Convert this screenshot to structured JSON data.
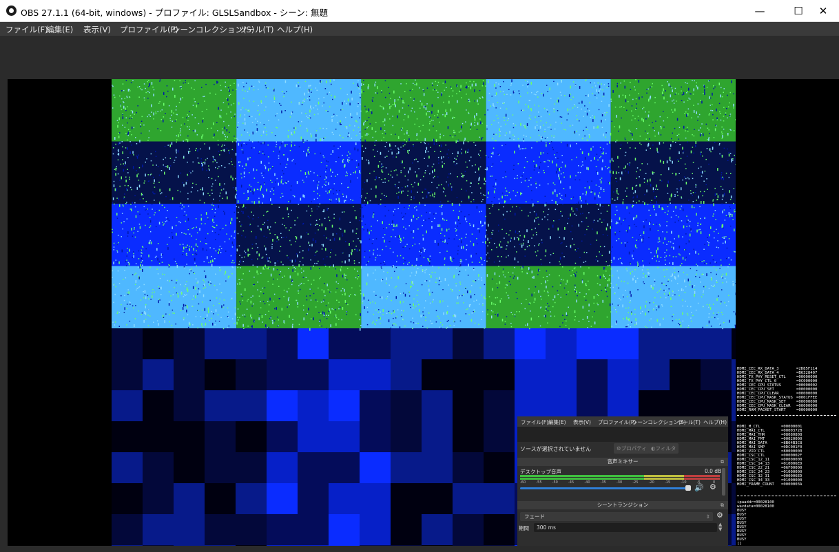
{
  "window": {
    "title": "OBS 27.1.1 (64-bit, windows) - プロファイル: GLSLSandbox - シーン: 無題",
    "controls": {
      "minimize": "—",
      "maximize": "☐",
      "close": "✕"
    }
  },
  "menu": [
    "ファイル(F)",
    "編集(E)",
    "表示(V)",
    "プロファイル(P)",
    "シーンコレクション(S)",
    "ツール(T)",
    "ヘルプ(H)"
  ],
  "register_dump_top": [
    [
      "HDMI_CEC_RX_DATA_3",
      "=2D85F114"
    ],
    [
      "HDMI_CEC_RX_DATA_4",
      "=B6328407"
    ],
    [
      "HDMI_TX_PHY_RESET_CTL",
      "=00000000"
    ],
    [
      "HDMI_TX_PHY_CTL_0",
      "=0C000000"
    ],
    [
      "HDMI_CEC_CPU_STATUS",
      "=00000002"
    ],
    [
      "HDMI_CEC_CPU_SET",
      "=00000000"
    ],
    [
      "HDMI_CEC_CPU_CLEAR",
      "=00000000"
    ],
    [
      "HDMI_CEC_CPU_MASK_STATUS",
      "=0001FFEE"
    ],
    [
      "HDMI_CEC_CPU_MASK_SET",
      "=00000000"
    ],
    [
      "HDMI_CEC_CPU_MASK_CLEAR",
      "=00000000"
    ],
    [
      "HDMI_RAM_PACKET_START",
      "=00000000"
    ]
  ],
  "register_dump_mid": [
    [
      "HDMI_M_CTL",
      "=00000001"
    ],
    [
      "HDMI_MAI_CTL",
      "=0000372B"
    ],
    [
      "HDMI_MAI_THR",
      "=08080808"
    ],
    [
      "HDMI_MAI_FMT",
      "=00020000"
    ],
    [
      "HDMI_MAI_DATA",
      "=8B64B3C8"
    ],
    [
      "HDMI_MAI_SMP",
      "=0DC001F0"
    ],
    [
      "HDMI_VID_CTL",
      "=80000000"
    ],
    [
      "HDMI_CSC_CTL",
      "=0000002F"
    ],
    [
      "HDMI_CSC_12_11",
      "=00000000"
    ],
    [
      "HDMI_CSC_14_13",
      "=010006ED"
    ],
    [
      "HDMI_CSC_22_21",
      "=06F00000"
    ],
    [
      "HDMI_CSC_24_23",
      "=01000000"
    ],
    [
      "HDMI_CSC_32_31",
      "=000006ED"
    ],
    [
      "HDMI_CSC_34_33",
      "=01000000"
    ],
    [
      "HDMI_FRAME_COUNT",
      "=0000003A"
    ]
  ],
  "register_dump_bottom": [
    "ipaaddr=00028100",
    "wavdata=00028100",
    "BUSY",
    "BUSY",
    "BUSY",
    "BUSY",
    "BUSY",
    "BUSY",
    "BUSY",
    "BUSY",
    "[]"
  ],
  "mini_obs": {
    "menu": [
      "ファイル(F)",
      "編集(E)",
      "表示(V)",
      "プロファイル(P)",
      "シーンコレクション(S)",
      "ツール(T)",
      "ヘルプ(H)"
    ],
    "no_source": "ソースが選択されていません",
    "properties_btn": "プロパティ",
    "filters_btn": "フィルタ",
    "audio_mixer_title": "音声ミキサー",
    "desktop_audio_label": "デスクトップ音声",
    "desktop_audio_db": "0.0 dB",
    "scale_ticks": [
      "-60",
      "-55",
      "-50",
      "-45",
      "-40",
      "-35",
      "-30",
      "-25",
      "-20",
      "-15",
      "-10",
      "-5",
      "0"
    ],
    "transition_title": "シーントランジション",
    "transition_value": "フェード",
    "duration_label": "期間",
    "duration_value": "300 ms"
  },
  "colors": {
    "tile_green": "#2fa52f",
    "tile_blue": "#0a2cff",
    "tile_cyan": "#4fb8ff",
    "dark_navy": "#05124a"
  }
}
